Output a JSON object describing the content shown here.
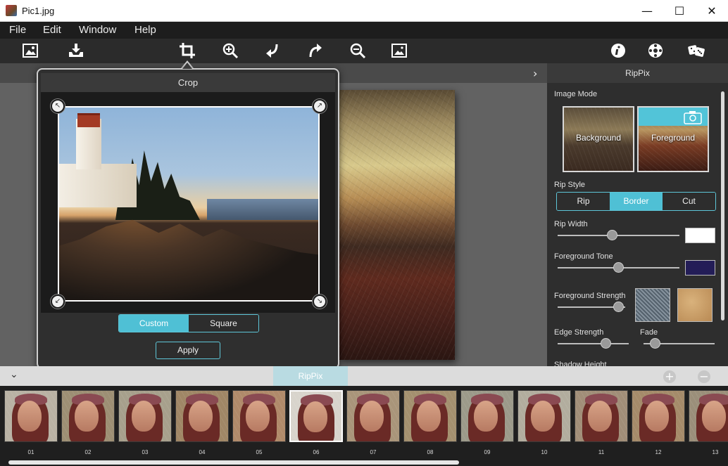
{
  "window": {
    "title": "Pic1.jpg",
    "controls": {
      "minimize": "—",
      "maximize": "☐",
      "close": "✕"
    }
  },
  "menu": [
    "File",
    "Edit",
    "Window",
    "Help"
  ],
  "toolbar": {
    "left_icons": [
      "open-image-icon",
      "save-icon",
      "crop-icon",
      "zoom-in-icon",
      "rotate-left-icon",
      "rotate-right-icon",
      "zoom-out-icon",
      "fit-image-icon"
    ],
    "right_icons": [
      "info-icon",
      "settings-icon",
      "dice-icon"
    ]
  },
  "crop": {
    "title": "Crop",
    "aspect_options": [
      "Custom",
      "Square"
    ],
    "aspect_selected": "Custom",
    "apply_label": "Apply"
  },
  "panel": {
    "title": "RipPix",
    "image_mode_label": "Image Mode",
    "image_modes": [
      "Background",
      "Foreground"
    ],
    "image_mode_selected": "Foreground",
    "rip_style_label": "Rip Style",
    "rip_styles": [
      "Rip",
      "Border",
      "Cut"
    ],
    "rip_style_selected": "Border",
    "rip_width_label": "Rip Width",
    "rip_width_value": 0.45,
    "rip_width_color": "#ffffff",
    "foreground_tone_label": "Foreground Tone",
    "foreground_tone_value": 0.5,
    "foreground_tone_color": "#231d57",
    "foreground_strength_label": "Foreground Strength",
    "foreground_strength_value": 0.9,
    "edge_strength_label": "Edge Strength",
    "edge_strength_value": 0.68,
    "fade_label": "Fade",
    "fade_value": 0.16,
    "shadow_height_label": "Shadow Height"
  },
  "bottom": {
    "tab_label": "RipPix",
    "add_label": "+",
    "remove_label": "−"
  },
  "filmstrip": {
    "items": [
      "01",
      "02",
      "03",
      "04",
      "05",
      "06",
      "07",
      "08",
      "09",
      "10",
      "11",
      "12",
      "13"
    ],
    "selected": "06"
  },
  "colors": {
    "accent": "#4fc0d5",
    "panel_bg": "#2e2e2e",
    "workspace_bg": "#626262"
  }
}
